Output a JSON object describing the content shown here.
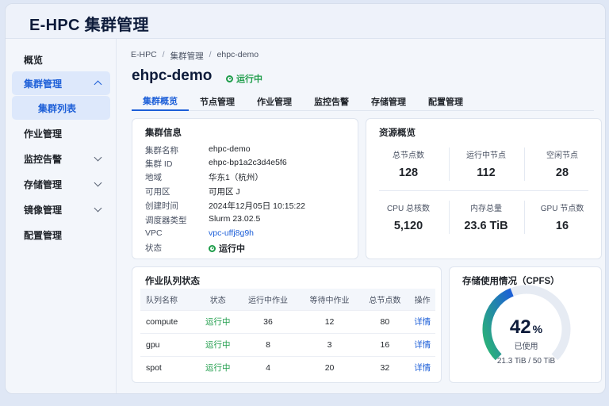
{
  "app": {
    "title": "E-HPC 集群管理"
  },
  "sidebar": {
    "items": [
      {
        "label": "概览"
      },
      {
        "label": "集群管理"
      },
      {
        "label": "集群列表"
      },
      {
        "label": "作业管理"
      },
      {
        "label": "监控告警"
      },
      {
        "label": "存储管理"
      },
      {
        "label": "镜像管理"
      },
      {
        "label": "配置管理"
      }
    ]
  },
  "breadcrumb": [
    "E-HPC",
    "/",
    "集群管理",
    "/",
    "ehpc-demo"
  ],
  "page": {
    "title": "ehpc-demo",
    "status": "运行中"
  },
  "tabs": [
    "集群概览",
    "节点管理",
    "作业管理",
    "监控告警",
    "存储管理",
    "配置管理"
  ],
  "cluster_info": {
    "title": "集群信息",
    "rows": [
      {
        "key": "集群名称",
        "value": "ehpc-demo"
      },
      {
        "key": "集群 ID",
        "value": "ehpc-bp1a2c3d4e5f6"
      },
      {
        "key": "地域",
        "value": "华东1（杭州）"
      },
      {
        "key": "可用区",
        "value": "可用区 J"
      },
      {
        "key": "创建时间",
        "value": "2024年12月05日 10:15:22"
      },
      {
        "key": "调度器类型",
        "value": "Slurm 23.02.5"
      },
      {
        "key": "VPC",
        "value": "vpc-uffj8g9h"
      },
      {
        "key": "状态",
        "value": "运行中"
      }
    ]
  },
  "resources": {
    "title": "资源概览",
    "metrics": [
      {
        "label": "总节点数",
        "value": "128"
      },
      {
        "label": "运行中节点",
        "value": "112"
      },
      {
        "label": "空闲节点",
        "value": "28"
      },
      {
        "label": "CPU 总核数",
        "value": "5,120"
      },
      {
        "label": "内存总量",
        "value": "23.6 TiB"
      },
      {
        "label": "GPU 节点数",
        "value": "16"
      }
    ]
  },
  "queues": {
    "title": "作业队列状态",
    "headers": [
      "队列名称",
      "状态",
      "运行中作业",
      "等待中作业",
      "总节点数",
      "操作"
    ],
    "rows": [
      [
        "compute",
        "运行中",
        "36",
        "12",
        "80",
        "详情"
      ],
      [
        "gpu",
        "运行中",
        "8",
        "3",
        "16",
        "详情"
      ],
      [
        "spot",
        "运行中",
        "4",
        "20",
        "32",
        "详情"
      ]
    ]
  },
  "storage": {
    "title": "存储使用情况（CPFS）",
    "percent": "42",
    "percent_sign": "%",
    "used_fraction": 0.42,
    "used_label": "已使用",
    "capacity": "21.3 TiB / 50 TiB",
    "colors": {
      "start": "#2bb673",
      "end": "#1d5fd8",
      "track": "#e6ebf3"
    }
  }
}
